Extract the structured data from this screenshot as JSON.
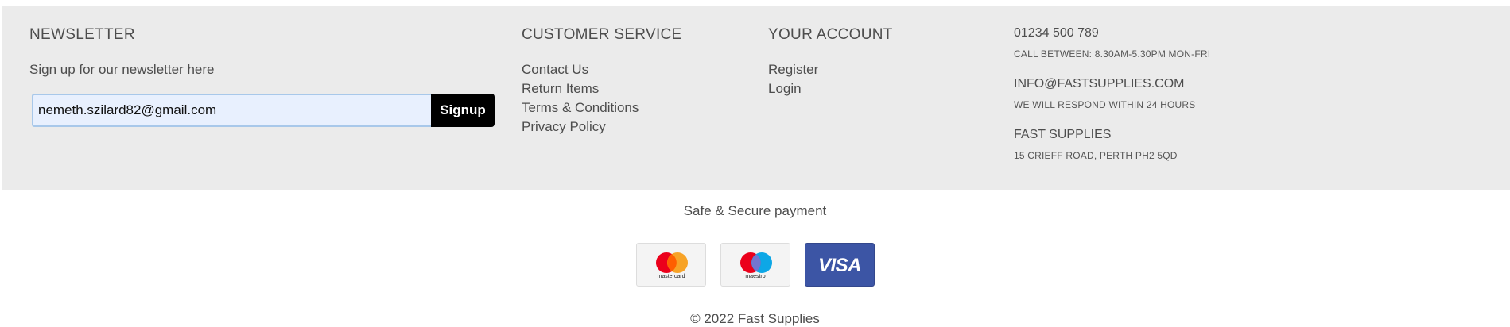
{
  "newsletter": {
    "title": "NEWSLETTER",
    "text": "Sign up for our newsletter here",
    "email_value": "nemeth.szilard82@gmail.com",
    "signup_label": "Signup"
  },
  "customer_service": {
    "title": "CUSTOMER SERVICE",
    "links": [
      "Contact Us",
      "Return Items",
      "Terms & Conditions",
      "Privacy Policy"
    ]
  },
  "account": {
    "title": "YOUR ACCOUNT",
    "links": [
      "Register",
      "Login"
    ]
  },
  "contact": {
    "phone": "01234 500 789",
    "phone_note": "CALL BETWEEN: 8.30AM-5.30PM MON-FRI",
    "email": "INFO@FASTSUPPLIES.COM",
    "email_note": "WE WILL RESPOND WITHIN 24 HOURS",
    "company": "FAST SUPPLIES",
    "address": "15 CRIEFF ROAD, PERTH PH2 5QD"
  },
  "payment": {
    "title": "Safe & Secure payment",
    "cards": [
      {
        "name": "mastercard",
        "label": "mastercard",
        "colors": [
          "#eb001b",
          "#f79e1b"
        ]
      },
      {
        "name": "maestro",
        "label": "maestro",
        "colors": [
          "#eb001b",
          "#00a2e5"
        ]
      },
      {
        "name": "visa",
        "label": "VISA",
        "colors": [
          "#3c55a5"
        ]
      }
    ]
  },
  "copyright": "© 2022 Fast Supplies"
}
